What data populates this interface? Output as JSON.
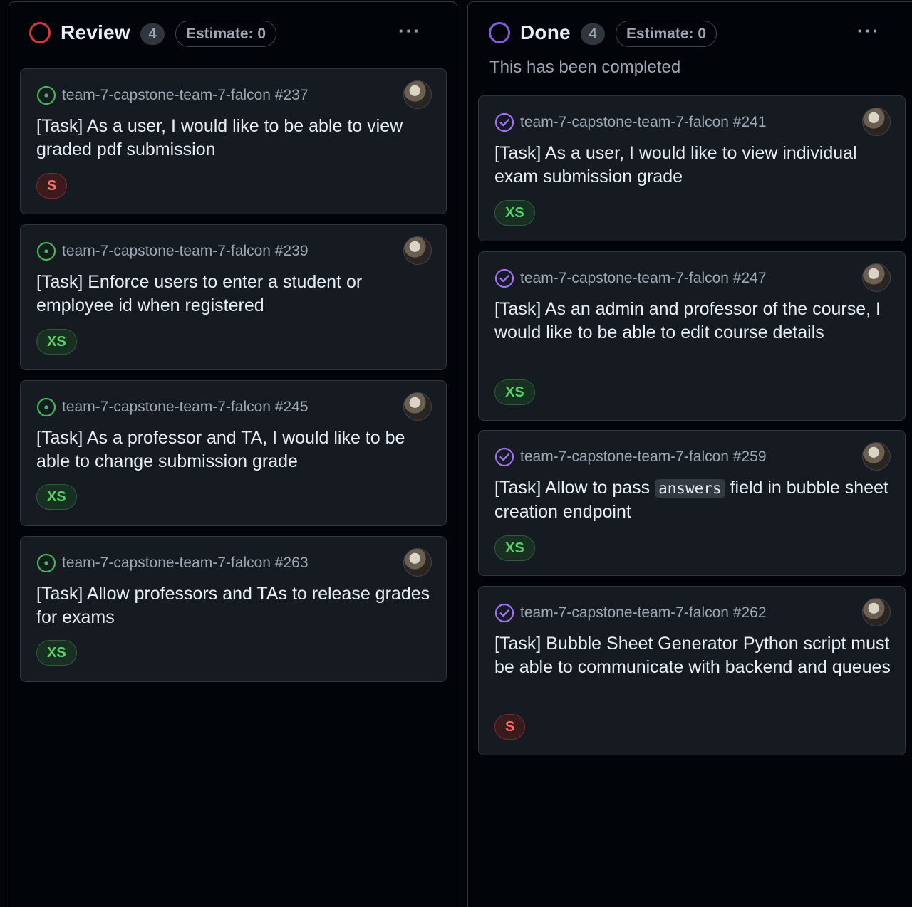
{
  "columns": [
    {
      "title": "Review",
      "count": "4",
      "estimate": "Estimate: 0",
      "ring_color": "#da3633",
      "more_label": "···",
      "cards": [
        {
          "repo": "team-7-capstone-team-7-falcon #237",
          "title": "[Task] As a user, I would like to be able to view graded pdf submission",
          "size": "S"
        },
        {
          "repo": "team-7-capstone-team-7-falcon #239",
          "title": "[Task] Enforce users to enter a student or employee id when registered",
          "size": "XS"
        },
        {
          "repo": "team-7-capstone-team-7-falcon #245",
          "title": "[Task] As a professor and TA, I would like to be able to change submission grade",
          "size": "XS"
        },
        {
          "repo": "team-7-capstone-team-7-falcon #263",
          "title": "[Task] Allow professors and TAs to release grades for exams",
          "size": "XS"
        }
      ]
    },
    {
      "title": "Done",
      "count": "4",
      "estimate": "Estimate: 0",
      "ring_color": "#8957e5",
      "more_label": "···",
      "description": "This has been completed",
      "cards": [
        {
          "repo": "team-7-capstone-team-7-falcon #241",
          "title": "[Task] As a user, I would like to view individual exam submission grade",
          "size": "XS"
        },
        {
          "repo": "team-7-capstone-team-7-falcon #247",
          "title": "[Task] As an admin and professor of the course, I would like to be able to edit course details",
          "size": "XS"
        },
        {
          "repo": "team-7-capstone-team-7-falcon #259",
          "title_before": "[Task] Allow to pass ",
          "title_code": "answers",
          "title_after": " field in bubble sheet creation endpoint",
          "size": "XS"
        },
        {
          "repo": "team-7-capstone-team-7-falcon #262",
          "title": "[Task] Bubble Sheet Generator Python script must be able to communicate with backend and queues",
          "size": "S"
        }
      ]
    }
  ],
  "colors": {
    "open_issue": "#3fb950",
    "closed_issue": "#a371f7",
    "size_s": "#ff6b6b",
    "size_xs": "#56d364"
  },
  "icons": {
    "open": "issue-opened-icon",
    "closed": "issue-closed-icon"
  }
}
